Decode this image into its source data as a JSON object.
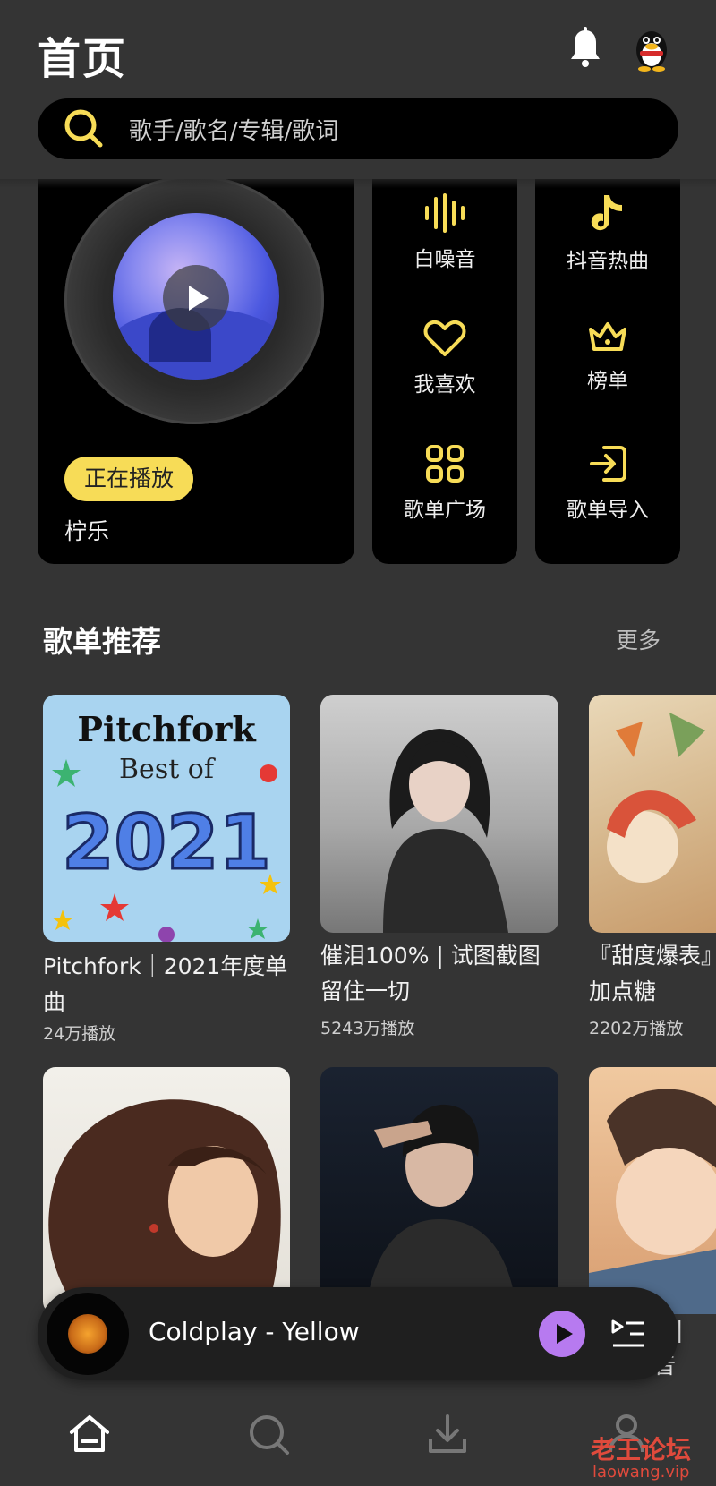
{
  "header": {
    "title": "首页",
    "search_placeholder": "歌手/歌名/专辑/歌词"
  },
  "now_playing_card": {
    "badge": "正在播放",
    "song": "柠乐"
  },
  "quick_grid": {
    "col1": [
      {
        "label": "白噪音",
        "icon": "sound-wave-icon"
      },
      {
        "label": "我喜欢",
        "icon": "heart-icon"
      },
      {
        "label": "歌单广场",
        "icon": "grid-icon"
      }
    ],
    "col2": [
      {
        "label": "抖音热曲",
        "icon": "tiktok-icon"
      },
      {
        "label": "榜单",
        "icon": "crown-icon"
      },
      {
        "label": "歌单导入",
        "icon": "import-icon"
      }
    ]
  },
  "playlist_section": {
    "title": "歌单推荐",
    "more": "更多",
    "items": [
      {
        "title_line1": "Pitchfork｜2021年度单",
        "title_line2": "曲",
        "plays": "24万播放",
        "cover_text1": "Pitchfork",
        "cover_text2": "Best of",
        "cover_text3": "2021"
      },
      {
        "title_line1": "催泪100% | 试图截图",
        "title_line2": "留住一切",
        "plays": "5243万播放"
      },
      {
        "title_line1": "『甜度爆表』",
        "title_line2": "加点糖",
        "plays": "2202万播放"
      }
    ],
    "row2_partial_text": "集 |",
    "row2_partial_text2": "音"
  },
  "mini_player": {
    "title": "Coldplay - Yellow"
  },
  "watermark": {
    "text": "老王论坛",
    "sub": "laowang.vip"
  },
  "colors": {
    "accent_yellow": "#f7dc57",
    "play_purple": "#b77af0",
    "background": "#343434"
  }
}
